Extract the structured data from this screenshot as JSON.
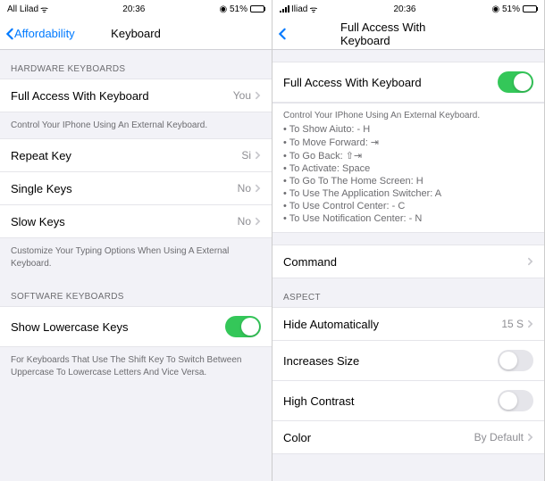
{
  "left": {
    "status": {
      "carrier": "All Lilad",
      "time": "20:36",
      "battery": "51%"
    },
    "nav": {
      "back": "Affordability",
      "title": "Keyboard"
    },
    "section1": {
      "header": "HARDWARE KEYBOARDS",
      "row1": {
        "label": "Full Access With Keyboard",
        "value": "You"
      },
      "footer1": "Control Your IPhone Using An External Keyboard.",
      "row2": {
        "label": "Repeat Key",
        "value": "Si"
      },
      "row3": {
        "label": "Single Keys",
        "value": "No"
      },
      "row4": {
        "label": "Slow Keys",
        "value": "No"
      },
      "footer2": "Customize Your Typing Options When Using A External Keyboard."
    },
    "section2": {
      "header": "SOFTWARE KEYBOARDS",
      "row1": {
        "label": "Show Lowercase Keys"
      },
      "footer": "For Keyboards That Use The Shift Key To Switch Between Uppercase To Lowercase Letters And Vice Versa."
    }
  },
  "right": {
    "status": {
      "carrier": "Iliad",
      "time": "20:36",
      "battery": "51%"
    },
    "nav": {
      "title": "Full Access With Keyboard"
    },
    "toggle": {
      "label": "Full Access With Keyboard"
    },
    "help": {
      "title": "Control Your IPhone Using An External Keyboard.",
      "items": [
        "To Show Aiuto: - H",
        "To Move Forward: ⇥",
        "To Go Back: ⇧⇥",
        "To Activate: Space",
        "To Go To The Home Screen: H",
        "To Use The Application Switcher: A",
        "To Use Control Center: - C",
        "To Use Notification Center: - N"
      ]
    },
    "command": {
      "label": "Command"
    },
    "section2": {
      "header": "ASPECT",
      "row1": {
        "label": "Hide Automatically",
        "value": "15 S"
      },
      "row2": {
        "label": "Increases Size"
      },
      "row3": {
        "label": "High Contrast"
      },
      "row4": {
        "label": "Color",
        "value": "By Default"
      }
    }
  }
}
